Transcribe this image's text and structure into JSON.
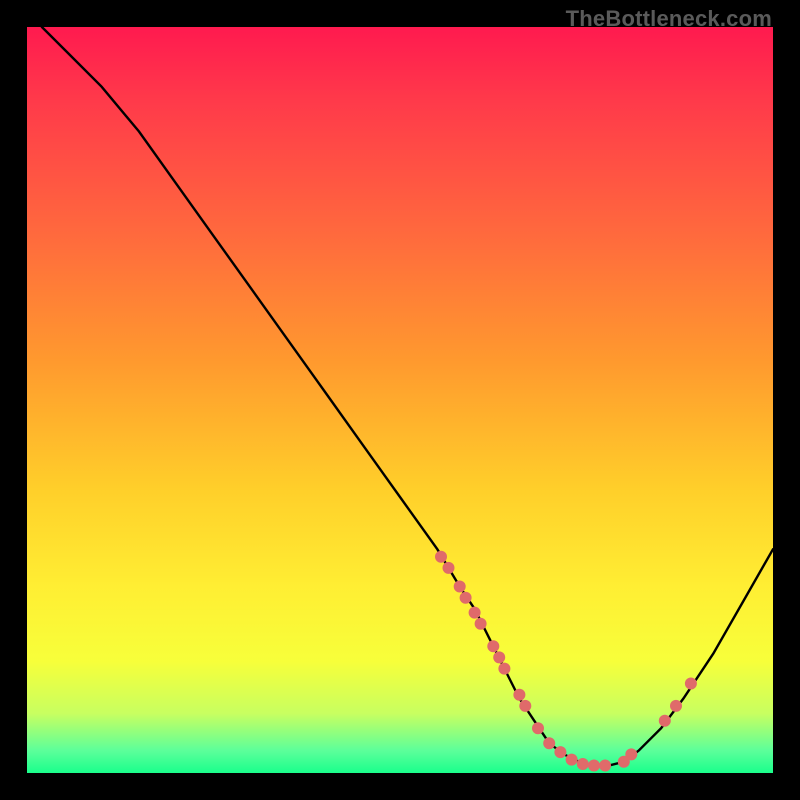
{
  "watermark": "TheBottleneck.com",
  "chart_data": {
    "type": "line",
    "title": "",
    "xlabel": "",
    "ylabel": "",
    "xlim": [
      0,
      100
    ],
    "ylim": [
      0,
      100
    ],
    "grid": false,
    "series": [
      {
        "name": "curve",
        "color": "#000000",
        "x": [
          2,
          5,
          10,
          15,
          20,
          25,
          30,
          35,
          40,
          45,
          50,
          55,
          58,
          60,
          62,
          64,
          66,
          68,
          70,
          72,
          74,
          76,
          78,
          80,
          82,
          85,
          88,
          92,
          96,
          100
        ],
        "y": [
          100,
          97,
          92,
          86,
          79,
          72,
          65,
          58,
          51,
          44,
          37,
          30,
          25,
          22,
          18,
          14,
          10,
          7,
          4,
          2.5,
          1.5,
          1,
          1,
          1.5,
          3,
          6,
          10,
          16,
          23,
          30
        ]
      }
    ],
    "scatter": {
      "name": "highlight-points",
      "color": "#e06a6a",
      "radius": 6,
      "points": [
        {
          "x": 55.5,
          "y": 29.0
        },
        {
          "x": 56.5,
          "y": 27.5
        },
        {
          "x": 58.0,
          "y": 25.0
        },
        {
          "x": 58.8,
          "y": 23.5
        },
        {
          "x": 60.0,
          "y": 21.5
        },
        {
          "x": 60.8,
          "y": 20.0
        },
        {
          "x": 62.5,
          "y": 17.0
        },
        {
          "x": 63.3,
          "y": 15.5
        },
        {
          "x": 64.0,
          "y": 14.0
        },
        {
          "x": 66.0,
          "y": 10.5
        },
        {
          "x": 66.8,
          "y": 9.0
        },
        {
          "x": 68.5,
          "y": 6.0
        },
        {
          "x": 70.0,
          "y": 4.0
        },
        {
          "x": 71.5,
          "y": 2.8
        },
        {
          "x": 73.0,
          "y": 1.8
        },
        {
          "x": 74.5,
          "y": 1.2
        },
        {
          "x": 76.0,
          "y": 1.0
        },
        {
          "x": 77.5,
          "y": 1.0
        },
        {
          "x": 80.0,
          "y": 1.5
        },
        {
          "x": 81.0,
          "y": 2.5
        },
        {
          "x": 85.5,
          "y": 7.0
        },
        {
          "x": 87.0,
          "y": 9.0
        },
        {
          "x": 89.0,
          "y": 12.0
        }
      ]
    }
  }
}
